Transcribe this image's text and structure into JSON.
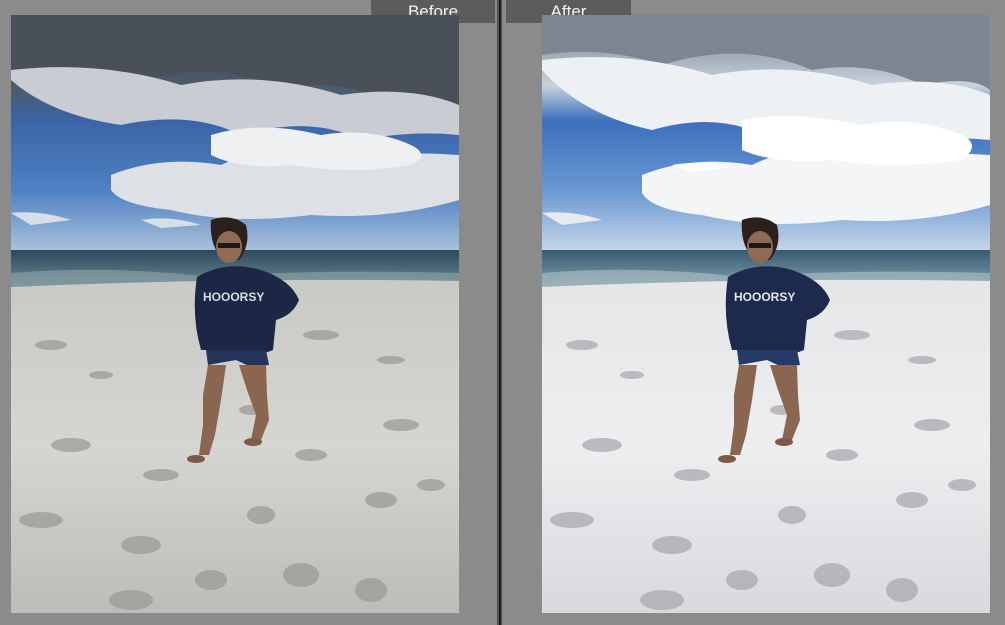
{
  "before_label": "Before",
  "after_label": "After",
  "photo_shirt_text": "HOOORSY",
  "colors": {
    "panel_bg": "#8b8b8b",
    "divider": "#1e1e1e",
    "label_bg": "#5c5c5c",
    "label_text": "#f2f2f2"
  }
}
